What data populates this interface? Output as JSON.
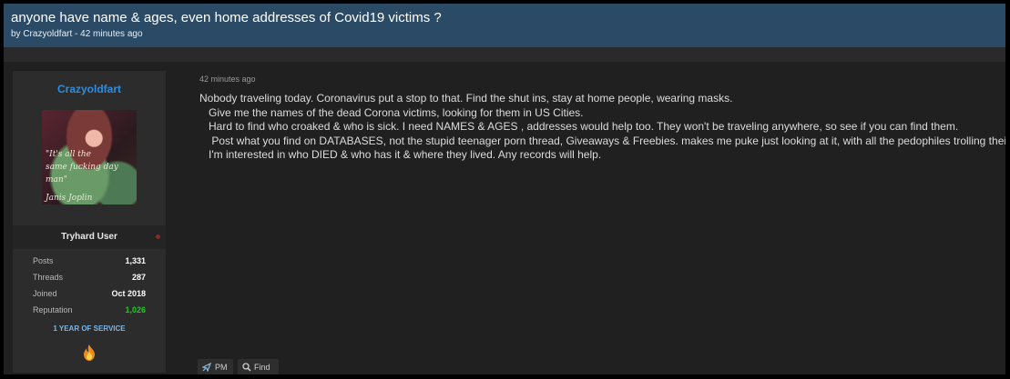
{
  "thread": {
    "title": "anyone have name & ages, even home addresses of Covid19 victims ?",
    "meta": "by Crazyoldfart - 42 minutes ago"
  },
  "user": {
    "name": "Crazyoldfart",
    "avatar_icon": "avatar-image",
    "avatar_quote": [
      "\"It's all the",
      "same fucking day man\"",
      "Janis Joplin"
    ],
    "title": "Tryhard User",
    "stats": [
      {
        "label": "Posts",
        "value": "1,331"
      },
      {
        "label": "Threads",
        "value": "287"
      },
      {
        "label": "Joined",
        "value": "Oct 2018"
      },
      {
        "label": "Reputation",
        "value": "1,026"
      }
    ],
    "service": "1 YEAR OF SERVICE",
    "badge_icon": "flame-icon"
  },
  "post": {
    "date": "42 minutes ago",
    "lines": [
      "Nobody traveling today. Coronavirus put a stop to that. Find the shut ins, stay at home people, wearing masks.",
      "   Give me the names of the dead Corona victims, looking for them in US Cities.",
      "   Hard to find who croaked & who is sick. I need NAMES & AGES , addresses would help too. They won't be traveling anywhere, so see if you can find them.",
      "    Post what you find on DATABASES, not the stupid teenager porn thread, Giveaways & Freebies. makes me puke just looking at it, with all the pedophiles trolling their.",
      "   I'm interested in who DIED & who has it & where they lived. Any records will help."
    ]
  },
  "actions": {
    "pm_label": "PM",
    "pm_icon": "pm-icon",
    "find_label": "Find",
    "find_icon": "search-icon"
  },
  "colors": {
    "header_bg": "#2b4a66",
    "username": "#2e8de0",
    "reputation": "#22c22a",
    "service": "#7bb6e6"
  }
}
